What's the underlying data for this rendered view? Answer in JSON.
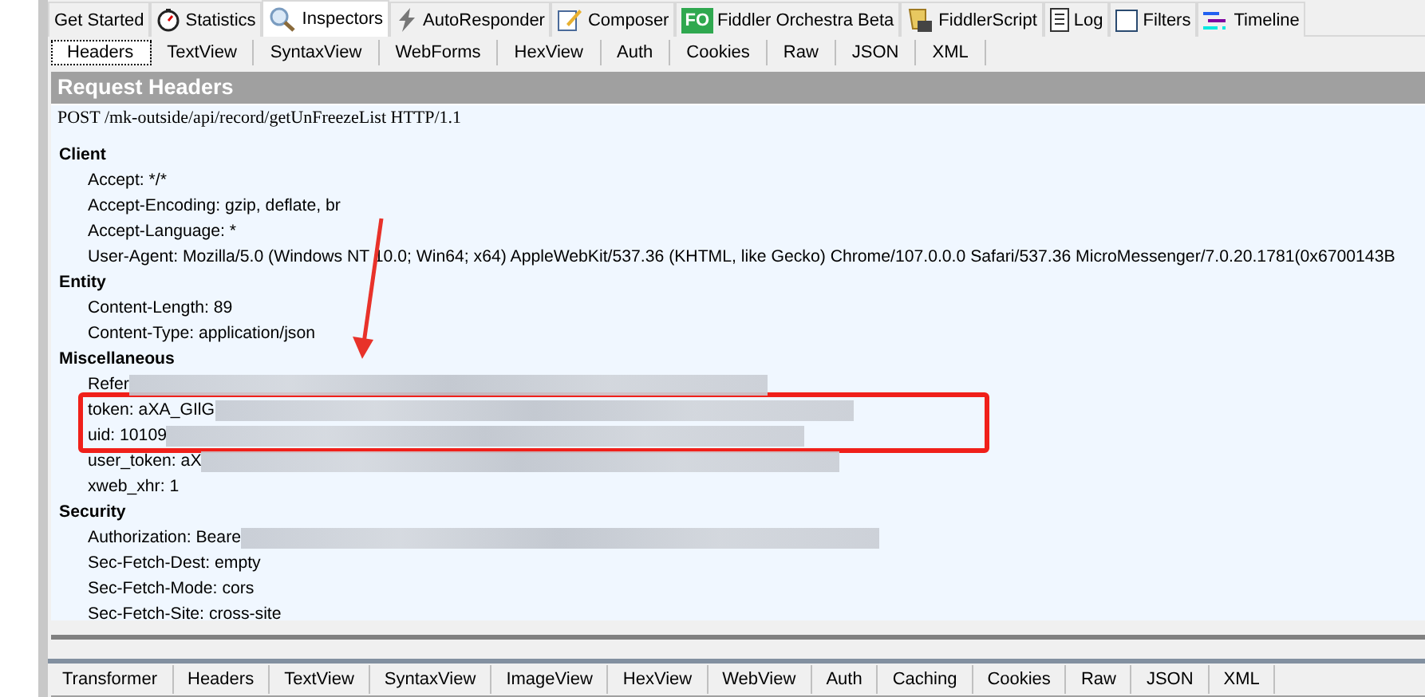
{
  "top_tabs": [
    {
      "label": "Get Started",
      "kind": "plain",
      "selected": false
    },
    {
      "label": "Statistics",
      "kind": "stopwatch",
      "selected": false
    },
    {
      "label": "Inspectors",
      "kind": "magnifier",
      "selected": true
    },
    {
      "label": "AutoResponder",
      "kind": "bolt",
      "selected": false
    },
    {
      "label": "Composer",
      "kind": "pencil",
      "selected": false
    },
    {
      "label": "Fiddler Orchestra Beta",
      "kind": "badge",
      "badge": "FO",
      "selected": false
    },
    {
      "label": "FiddlerScript",
      "kind": "scroll",
      "selected": false
    },
    {
      "label": "Log",
      "kind": "log",
      "selected": false
    },
    {
      "label": "Filters",
      "kind": "checkbox",
      "selected": false
    },
    {
      "label": "Timeline",
      "kind": "timeline",
      "selected": false
    }
  ],
  "request_tabs": [
    {
      "label": "Headers",
      "selected": true
    },
    {
      "label": "TextView",
      "selected": false
    },
    {
      "label": "SyntaxView",
      "selected": false
    },
    {
      "label": "WebForms",
      "selected": false
    },
    {
      "label": "HexView",
      "selected": false
    },
    {
      "label": "Auth",
      "selected": false
    },
    {
      "label": "Cookies",
      "selected": false
    },
    {
      "label": "Raw",
      "selected": false
    },
    {
      "label": "JSON",
      "selected": false
    },
    {
      "label": "XML",
      "selected": false
    }
  ],
  "panel_title": "Request Headers",
  "request_line": "POST /mk-outside/api/record/getUnFreezeList HTTP/1.1",
  "groups": [
    {
      "name": "Client",
      "headers": [
        {
          "text": "Accept: */*",
          "redacted": false
        },
        {
          "text": "Accept-Encoding: gzip, deflate, br",
          "redacted": false
        },
        {
          "text": "Accept-Language: *",
          "redacted": false
        },
        {
          "text": "User-Agent: Mozilla/5.0 (Windows NT 10.0; Win64; x64) AppleWebKit/537.36 (KHTML, like Gecko) Chrome/107.0.0.0 Safari/537.36 MicroMessenger/7.0.20.1781(0x6700143B",
          "redacted": false
        }
      ]
    },
    {
      "name": "Entity",
      "headers": [
        {
          "text": "Content-Length: 89",
          "redacted": false
        },
        {
          "text": "Content-Type: application/json",
          "redacted": false
        }
      ]
    },
    {
      "name": "Miscellaneous",
      "headers": [
        {
          "text": "Refer",
          "redacted": true
        },
        {
          "text": "token: aXA_GIlG",
          "redacted": true,
          "highlighted": true
        },
        {
          "text": "uid: 10109",
          "redacted": true,
          "highlighted": true
        },
        {
          "text": "user_token: aX",
          "redacted": true
        },
        {
          "text": "xweb_xhr: 1",
          "redacted": false
        }
      ]
    },
    {
      "name": "Security",
      "headers": [
        {
          "text": "Authorization: Beare",
          "redacted": true
        },
        {
          "text": "Sec-Fetch-Dest: empty",
          "redacted": false
        },
        {
          "text": "Sec-Fetch-Mode: cors",
          "redacted": false
        },
        {
          "text": "Sec-Fetch-Site: cross-site",
          "redacted": false
        }
      ]
    }
  ],
  "response_tabs": [
    {
      "label": "Transformer",
      "selected": false
    },
    {
      "label": "Headers",
      "selected": false
    },
    {
      "label": "TextView",
      "selected": false
    },
    {
      "label": "SyntaxView",
      "selected": false
    },
    {
      "label": "ImageView",
      "selected": false
    },
    {
      "label": "HexView",
      "selected": false
    },
    {
      "label": "WebView",
      "selected": false
    },
    {
      "label": "Auth",
      "selected": false
    },
    {
      "label": "Caching",
      "selected": false
    },
    {
      "label": "Cookies",
      "selected": false
    },
    {
      "label": "Raw",
      "selected": false
    },
    {
      "label": "JSON",
      "selected": false
    },
    {
      "label": "XML",
      "selected": false
    }
  ]
}
